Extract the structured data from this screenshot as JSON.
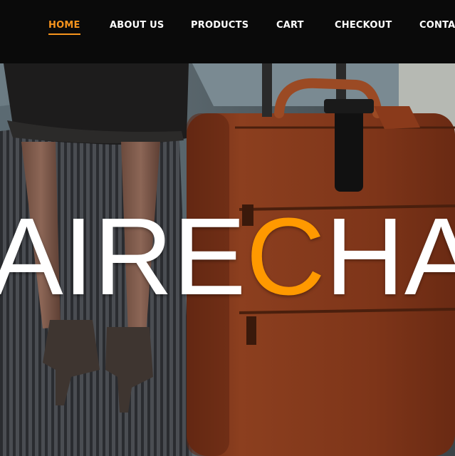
{
  "nav": {
    "items": [
      {
        "label": "HOME",
        "active": true
      },
      {
        "label": "ABOUT US",
        "active": false
      },
      {
        "label": "PRODUCTS",
        "active": false
      },
      {
        "label": "CART",
        "active": false
      },
      {
        "label": "CHECKOUT",
        "active": false
      },
      {
        "label": "CONTAC",
        "active": false
      }
    ],
    "active_color": "#f7941d",
    "text_color": "#ffffff",
    "background": "#0a0a0a"
  },
  "hero": {
    "title_before": "AIRE",
    "title_accent": "C",
    "title_after": "HA",
    "accent_color": "#ff9900",
    "image": "woman-with-brown-leather-suitcase"
  }
}
